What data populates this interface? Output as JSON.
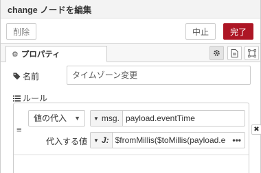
{
  "dialog": {
    "title": "change ノードを編集"
  },
  "buttons": {
    "delete": "削除",
    "cancel": "中止",
    "done": "完了"
  },
  "tabs": {
    "properties": "プロパティ"
  },
  "name": {
    "label": "名前",
    "value": "タイムゾーン変更"
  },
  "rules": {
    "label": "ルール",
    "items": [
      {
        "action": "値の代入",
        "target_type": "msg.",
        "target_value": "payload.eventTime",
        "value_label": "代入する値",
        "value_type": "J:",
        "value_expr": "$fromMillis($toMillis(payload.event"
      }
    ]
  },
  "colors": {
    "done_button": "#ad1625"
  }
}
